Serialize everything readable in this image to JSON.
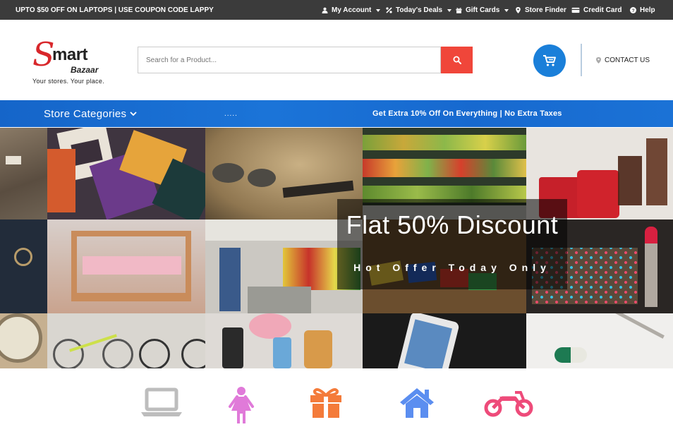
{
  "topbar": {
    "promo": "UPTO $50 OFF ON LAPTOPS | USE COUPON CODE LAPPY",
    "links": [
      {
        "label": "My Account",
        "icon": "user-icon",
        "dropdown": true
      },
      {
        "label": "Today's Deals",
        "icon": "percent-icon",
        "dropdown": true
      },
      {
        "label": "Gift Cards",
        "icon": "gift-icon",
        "dropdown": true
      },
      {
        "label": "Store Finder",
        "icon": "map-marker-icon",
        "dropdown": false
      },
      {
        "label": "Credit Card",
        "icon": "credit-card-icon",
        "dropdown": false
      },
      {
        "label": "Help",
        "icon": "question-circle-icon",
        "dropdown": false
      }
    ]
  },
  "header": {
    "logo": {
      "letter": "S",
      "word": "mart",
      "sub": "Bazaar",
      "tagline": "Your stores. Your place."
    },
    "search": {
      "placeholder": "Search for a Product..."
    },
    "contact": "CONTACT US"
  },
  "navbar": {
    "categories": "Store Categories",
    "dots": ".....",
    "offer": "Get Extra 10% Off On Everything | No Extra Taxes"
  },
  "hero": {
    "title": "Flat 50% Discount",
    "subtitle": "Hot Offer Today Only"
  },
  "categories_icons": [
    "laptop-icon",
    "female-icon",
    "gift-icon",
    "home-icon",
    "motorcycle-icon"
  ],
  "colors": {
    "topbar": "#3b3b3b",
    "search_button": "#f0463a",
    "cart": "#1a7fd9",
    "navbar": "#1b6fd3",
    "icon_laptop": "#bdbdbd",
    "icon_female": "#e07ad9",
    "icon_gift": "#f47b3a",
    "icon_home": "#5b8ef0",
    "icon_motorcycle": "#ee4b7a"
  }
}
